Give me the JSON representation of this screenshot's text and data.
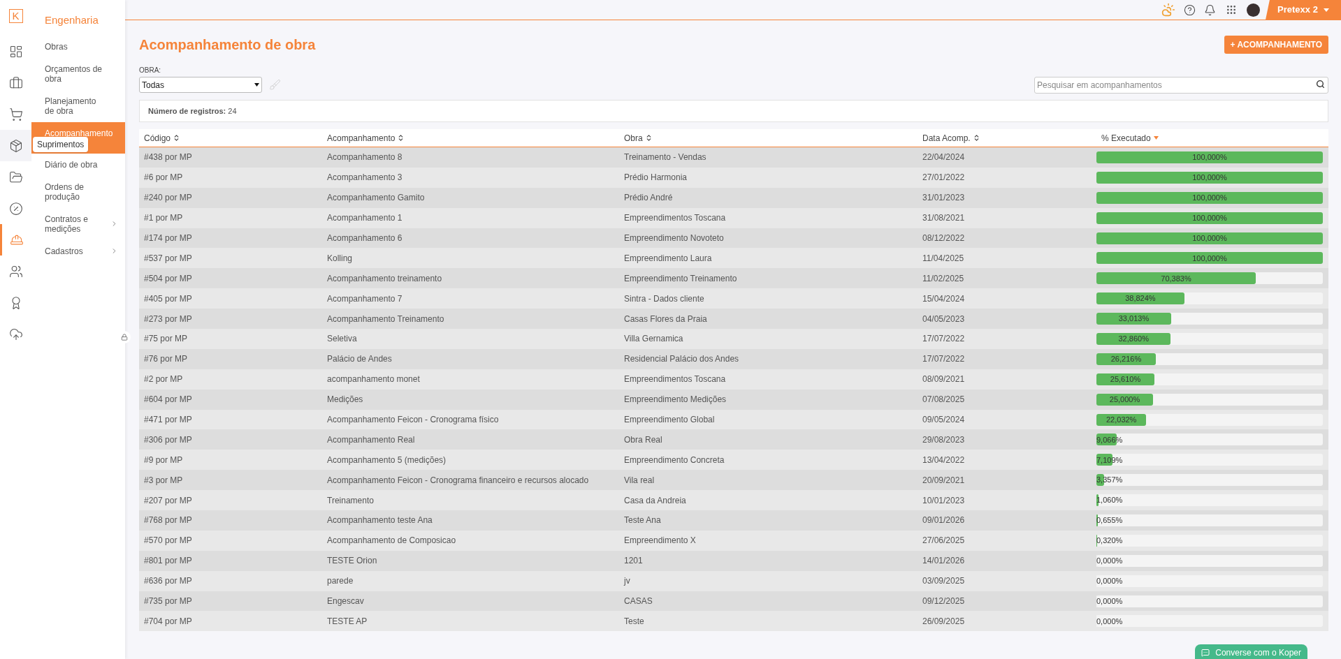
{
  "rail": {
    "logo": "K",
    "items": [
      {
        "kind": "dashboard",
        "selected": false
      },
      {
        "kind": "briefcase",
        "selected": false
      },
      {
        "kind": "cart",
        "selected": false
      },
      {
        "kind": "package",
        "selected": false,
        "tooltip": "Suprimentos"
      },
      {
        "kind": "folder",
        "selected": false
      },
      {
        "kind": "percent",
        "selected": false
      },
      {
        "kind": "worker",
        "selected": true
      },
      {
        "kind": "people",
        "selected": false
      },
      {
        "kind": "award",
        "selected": false
      },
      {
        "kind": "upload",
        "selected": false
      }
    ]
  },
  "menu": {
    "title": "Engenharia",
    "items": [
      {
        "label": "Obras",
        "selected": false,
        "submenu": false
      },
      {
        "label": "Orçamentos de obra",
        "selected": false,
        "submenu": false
      },
      {
        "label": "Planejamento de obra",
        "selected": false,
        "submenu": false
      },
      {
        "label": "Acompanhamento",
        "selected": true,
        "submenu": false
      },
      {
        "label": "Diário de obra",
        "selected": false,
        "submenu": false
      },
      {
        "label": "Ordens de produção",
        "selected": false,
        "submenu": false
      },
      {
        "label": "Contratos e medições",
        "selected": false,
        "submenu": true
      },
      {
        "label": "Cadastros",
        "selected": false,
        "submenu": true
      }
    ]
  },
  "topbar": {
    "account": "Pretexx 2"
  },
  "page": {
    "title": "Acompanhamento de obra",
    "new_button": "+ ACOMPANHAMENTO"
  },
  "filter": {
    "label": "OBRA:",
    "value": "Todas"
  },
  "search": {
    "placeholder": "Pesquisar em acompanhamentos"
  },
  "record_count": "**Número de registros:** 24",
  "table": {
    "columns": [
      {
        "label": "Código",
        "sorted": false
      },
      {
        "label": "Acompanhamento",
        "sorted": false
      },
      {
        "label": "Obra",
        "sorted": false
      },
      {
        "label": "Data Acomp.",
        "sorted": false
      },
      {
        "label": "% Executado",
        "sorted": true
      }
    ],
    "rows": [
      {
        "code": "#438 por MP",
        "name": "Acompanhamento 8",
        "obra": "Treinamento - Vendas",
        "date": "22/04/2024",
        "executed": "100,000%",
        "level": 1
      },
      {
        "code": "#6 por MP",
        "name": "Acompanhamento 3",
        "obra": "Prédio Harmonia",
        "date": "27/01/2022",
        "executed": "100,000%",
        "level": 1
      },
      {
        "code": "#240 por MP",
        "name": "Acompanhamento Gamito",
        "obra": "Prédio André",
        "date": "31/01/2023",
        "executed": "100,000%",
        "level": 1
      },
      {
        "code": "#1 por MP",
        "name": "Acompanhamento 1",
        "obra": "Empreendimentos Toscana",
        "date": "31/08/2021",
        "executed": "100,000%",
        "level": 1
      },
      {
        "code": "#174 por MP",
        "name": "Acompanhamento 6",
        "obra": "Empreendimento Novoteto",
        "date": "08/12/2022",
        "executed": "100,000%",
        "level": 1
      },
      {
        "code": "#537 por MP",
        "name": "Kolling",
        "obra": "Empreendimento Laura",
        "date": "11/04/2025",
        "executed": "100,000%",
        "level": 1
      },
      {
        "code": "#504 por MP",
        "name": "Acompanhamento treinamento",
        "obra": "Empreendimento Treinamento",
        "date": "11/02/2025",
        "executed": "70,383%",
        "level": 0.70383
      },
      {
        "code": "#405 por MP",
        "name": "Acompanhamento 7",
        "obra": "Sintra - Dados cliente",
        "date": "15/04/2024",
        "executed": "38,824%",
        "level": 0.38824
      },
      {
        "code": "#273 por MP",
        "name": "Acompanhamento Treinamento",
        "obra": "Casas Flores da Praia",
        "date": "04/05/2023",
        "executed": "33,013%",
        "level": 0.33013
      },
      {
        "code": "#75 por MP",
        "name": "Seletiva",
        "obra": "Villa Gernamica",
        "date": "17/07/2022",
        "executed": "32,860%",
        "level": 0.3286
      },
      {
        "code": "#76 por MP",
        "name": "Palácio de Andes",
        "obra": "Residencial Palácio dos Andes",
        "date": "17/07/2022",
        "executed": "26,216%",
        "level": 0.26216
      },
      {
        "code": "#2 por MP",
        "name": "acompanhamento monet",
        "obra": "Empreendimentos Toscana",
        "date": "08/09/2021",
        "executed": "25,610%",
        "level": 0.2561
      },
      {
        "code": "#604 por MP",
        "name": "Medições",
        "obra": "Empreendimento Medições",
        "date": "07/08/2025",
        "executed": "25,000%",
        "level": 0.25
      },
      {
        "code": "#471 por MP",
        "name": "Acompanhamento Feicon - Cronograma físico",
        "obra": "Empreendimento Global",
        "date": "09/05/2024",
        "executed": "22,032%",
        "level": 0.22032
      },
      {
        "code": "#306 por MP",
        "name": "Acompanhamento Real",
        "obra": "Obra Real",
        "date": "29/08/2023",
        "executed": "9,066%",
        "level": 0.09066
      },
      {
        "code": "#9 por MP",
        "name": "Acompanhamento 5 (medições)",
        "obra": "Empreendimento Concreta",
        "date": "13/04/2022",
        "executed": "7,109%",
        "level": 0.07109
      },
      {
        "code": "#3 por MP",
        "name": "Acompanhamento Feicon - Cronograma financeiro e recursos alocado",
        "obra": "Vila real",
        "date": "20/09/2021",
        "executed": "3,357%",
        "level": 0.03357
      },
      {
        "code": "#207 por MP",
        "name": "Treinamento",
        "obra": "Casa da Andreia",
        "date": "10/01/2023",
        "executed": "1,060%",
        "level": 0.0106
      },
      {
        "code": "#768 por MP",
        "name": "Acompanhamento teste Ana",
        "obra": "Teste Ana",
        "date": "09/01/2026",
        "executed": "0,655%",
        "level": 0.00655
      },
      {
        "code": "#570 por MP",
        "name": "Acompanhamento de Composicao",
        "obra": "Empreendimento X",
        "date": "27/06/2025",
        "executed": "0,320%",
        "level": 0.0032
      },
      {
        "code": "#801 por MP",
        "name": "TESTE Orion",
        "obra": "1201",
        "date": "14/01/2026",
        "executed": "0,000%",
        "level": 0
      },
      {
        "code": "#636 por MP",
        "name": "parede",
        "obra": "jv",
        "date": "03/09/2025",
        "executed": "0,000%",
        "level": 0
      },
      {
        "code": "#735 por MP",
        "name": "Engescav",
        "obra": "CASAS",
        "date": "09/12/2025",
        "executed": "0,000%",
        "level": 0
      },
      {
        "code": "#704 por MP",
        "name": "TESTE AP",
        "obra": "Teste",
        "date": "26/09/2025",
        "executed": "0,000%",
        "level": 0
      }
    ]
  },
  "chat_button": "Converse com o Koper"
}
